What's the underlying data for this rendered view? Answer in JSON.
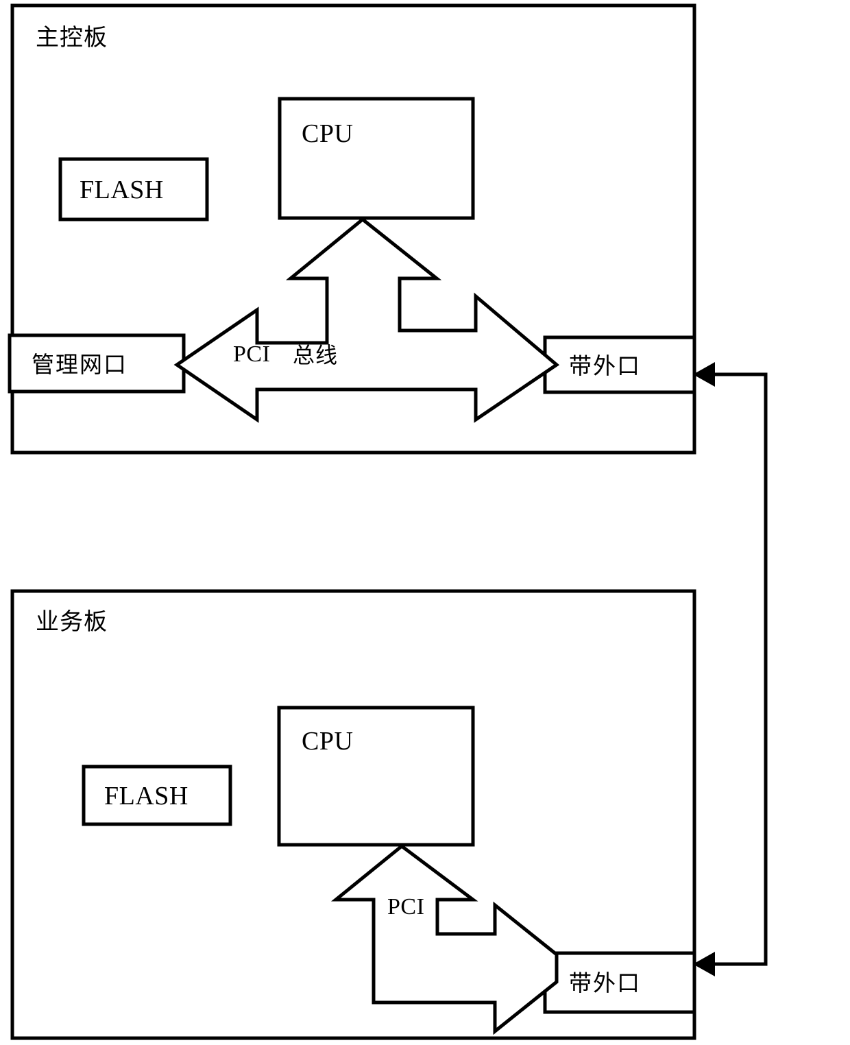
{
  "diagram": {
    "title_top": "主控板",
    "title_bottom": "业务板",
    "panels": [
      {
        "id": "main-control-board",
        "label": "主控板",
        "boxes": [
          {
            "id": "flash-top",
            "label": "FLASH",
            "script": "latin"
          },
          {
            "id": "cpu-top",
            "label": "CPU",
            "script": "latin"
          },
          {
            "id": "mgmt-port",
            "label": "管理网口",
            "script": "cjk"
          },
          {
            "id": "oob-port-top",
            "label": "带外口",
            "script": "cjk"
          }
        ],
        "bus": {
          "id": "pci-bus-top",
          "label_latin": "PCI",
          "label_cjk": "总线",
          "full": "PCI 总线"
        }
      },
      {
        "id": "service-board",
        "label": "业务板",
        "boxes": [
          {
            "id": "flash-bottom",
            "label": "FLASH",
            "script": "latin"
          },
          {
            "id": "cpu-bottom",
            "label": "CPU",
            "script": "latin"
          },
          {
            "id": "oob-port-bottom",
            "label": "带外口",
            "script": "cjk"
          }
        ],
        "bus": {
          "id": "pci-bus-bottom",
          "label_latin": "PCI",
          "label_cjk": "",
          "full": "PCI"
        }
      }
    ],
    "connector": {
      "id": "oob-interconnect",
      "from": "oob-port-top",
      "to": "oob-port-bottom",
      "label": ""
    },
    "colors": {
      "stroke": "#000000",
      "fill": "#ffffff",
      "background": "#ffffff"
    }
  }
}
